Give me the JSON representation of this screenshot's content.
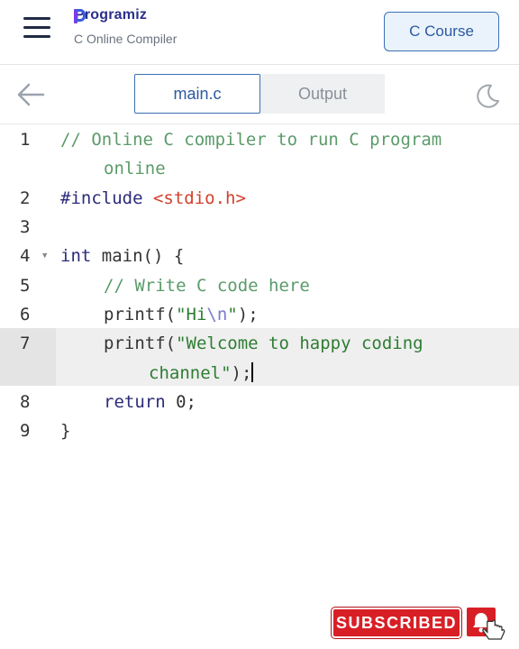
{
  "header": {
    "brand": "Programiz",
    "subtitle": "C Online Compiler",
    "course_button": "C Course"
  },
  "tabs": {
    "main_label": "main.c",
    "output_label": "Output"
  },
  "editor": {
    "line_numbers": [
      "1",
      "2",
      "3",
      "4",
      "5",
      "6",
      "7",
      "8",
      "9"
    ],
    "lines": {
      "l1a": "// Online C compiler to run C program",
      "l1b": "online",
      "l2_directive": "#include ",
      "l2_header": "<stdio.h>",
      "l4_kw": "int",
      "l4_rest": " main() {",
      "l5": "// Write C code here",
      "l6_fn": "printf(",
      "l6_str1": "\"Hi",
      "l6_esc": "\\n",
      "l6_str2": "\"",
      "l6_end": ");",
      "l7_fn": "printf(",
      "l7_str": "\"Welcome to happy coding",
      "l7b_str": "channel\"",
      "l7b_end": ");",
      "l8_kw": "return",
      "l8_rest": " 0;",
      "l9": "}"
    }
  },
  "overlay": {
    "subscribe_label": "SUBSCRIBED"
  },
  "colors": {
    "accent": "#3d6fb4",
    "comment": "#5b9b6a",
    "string": "#2e7d32",
    "include": "#d2402b",
    "subscribe": "#d81f26"
  }
}
